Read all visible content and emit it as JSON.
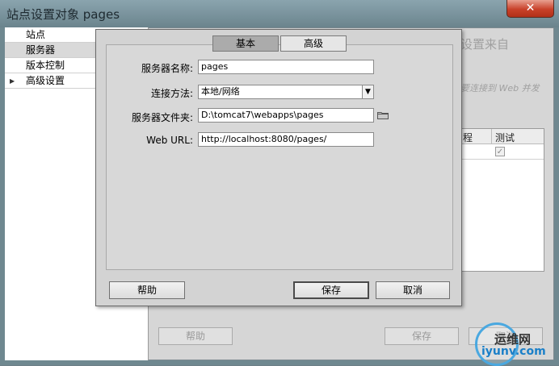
{
  "window": {
    "title": "站点设置对象 pages",
    "close_glyph": "✕"
  },
  "categories": [
    {
      "label": "站点",
      "selected": false,
      "has_arrow": false
    },
    {
      "label": "服务器",
      "selected": true,
      "has_arrow": false
    },
    {
      "label": "版本控制",
      "selected": false,
      "has_arrow": false
    },
    {
      "label": "高级设置",
      "selected": false,
      "has_arrow": true
    }
  ],
  "background": {
    "heading_fragment": "设置来自",
    "note_fragment": "要连接到 Web 并发",
    "table_headers": [
      "程",
      "测试"
    ],
    "test_checked": true,
    "help_label": "帮助",
    "save_label": "保存",
    "cancel_label": "取消"
  },
  "dialog": {
    "tabs": [
      {
        "label": "基本",
        "active": true
      },
      {
        "label": "高级",
        "active": false
      }
    ],
    "fields": {
      "server_name_label": "服务器名称:",
      "server_name_value": "pages",
      "connect_method_label": "连接方法:",
      "connect_method_value": "本地/网络",
      "server_folder_label": "服务器文件夹:",
      "server_folder_value": "D:\\tomcat7\\webapps\\pages",
      "web_url_label": "Web URL:",
      "web_url_value": "http://localhost:8080/pages/"
    },
    "buttons": {
      "help": "帮助",
      "save": "保存",
      "cancel": "取消"
    }
  },
  "watermark": {
    "line1": "运维网",
    "line2": "iyunv.com"
  },
  "icons": {
    "close": "close-icon",
    "dropdown": "chevron-down-icon",
    "folder": "folder-icon",
    "expand": "triangle-right-icon"
  }
}
